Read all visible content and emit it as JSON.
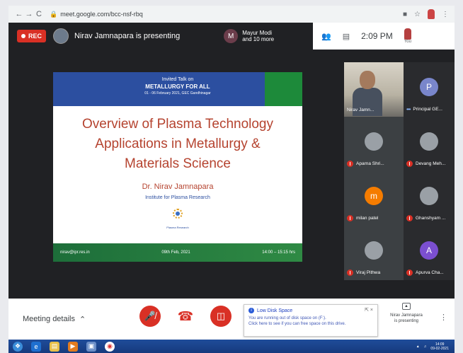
{
  "browser": {
    "url": "meet.google.com/bcc-nsf-rbq",
    "back_icon": "←",
    "forward_icon": "→",
    "reload_icon": "C"
  },
  "meet": {
    "rec_label": "REC",
    "presenting_text": "Nirav Jamnapara is presenting",
    "others_initial": "M",
    "others_line1": "Mayur Modi",
    "others_line2": "and 10 more",
    "time": "2:09 PM",
    "you_label": "You"
  },
  "slide": {
    "header_line1": "Invited Talk on",
    "header_line2": "METALLURGY FOR ALL",
    "header_line3": "01 - 06 February 2021, GEC Gandhinagar",
    "title_line1": "Overview of Plasma Technology",
    "title_line2": "Applications in Metallurgy &",
    "title_line3": "Materials Science",
    "author": "Dr. Nirav Jamnapara",
    "institute": "Institute for Plasma Research",
    "logo_caption": "Plasma Research",
    "footer_email": "nirav@ipr.res.in",
    "footer_date": "09th Feb, 2021",
    "footer_time": "14:00 – 15:15 hrs"
  },
  "participants": [
    {
      "name": "Nirav Jamn...",
      "type": "camera",
      "muted": false
    },
    {
      "name": "Principal GE...",
      "initial": "P",
      "color": "#7986cb",
      "muted": false,
      "dots": true
    },
    {
      "name": "Aparna Shri...",
      "type": "photo",
      "muted": true
    },
    {
      "name": "Devang Meh...",
      "type": "photo",
      "muted": true
    },
    {
      "name": "milan patel",
      "initial": "m",
      "color": "#f57c00",
      "muted": true
    },
    {
      "name": "Ghanshyam ...",
      "type": "photo",
      "muted": true
    },
    {
      "name": "Viraj Pithwa",
      "type": "photo",
      "muted": true
    },
    {
      "name": "Apurva Cha...",
      "initial": "A",
      "color": "#7b4fd0",
      "muted": true
    }
  ],
  "bottom": {
    "meeting_details": "Meeting details",
    "presenter_line1": "Nirav Jamnapara",
    "presenter_line2": "is presenting"
  },
  "toast": {
    "title": "Low Disk Space",
    "line1": "You are running out of disk space on (F:).",
    "line2": "Click here to see if you can free space on this drive."
  },
  "taskbar": {
    "time": "14:09",
    "date": "09-02-2021"
  }
}
